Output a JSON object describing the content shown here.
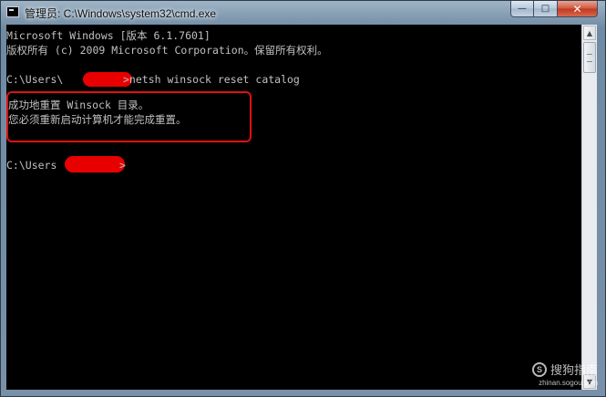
{
  "window": {
    "title": "管理员: C:\\Windows\\system32\\cmd.exe",
    "buttons": {
      "minimize": "—",
      "maximize": "□",
      "close": "✕"
    }
  },
  "console": {
    "lines": [
      "Microsoft Windows [版本 6.1.7601]",
      "版权所有 (c) 2009 Microsoft Corporation。保留所有权利。",
      "C:\\Users\\",
      ">netsh winsock reset catalog",
      "成功地重置 Winsock 目录。",
      "您必须重新启动计算机才能完成重置。",
      "C:\\Users",
      ">"
    ]
  },
  "scrollbar": {
    "up_icon": "up-arrow-icon",
    "down_icon": "down-arrow-icon"
  },
  "watermark": {
    "brand": "搜狗指南",
    "url": "zhinan.sogou.com"
  },
  "colors": {
    "console_bg": "#000000",
    "console_text": "#c0c0c0",
    "highlight": "#e01010",
    "redaction": "#e80000"
  }
}
